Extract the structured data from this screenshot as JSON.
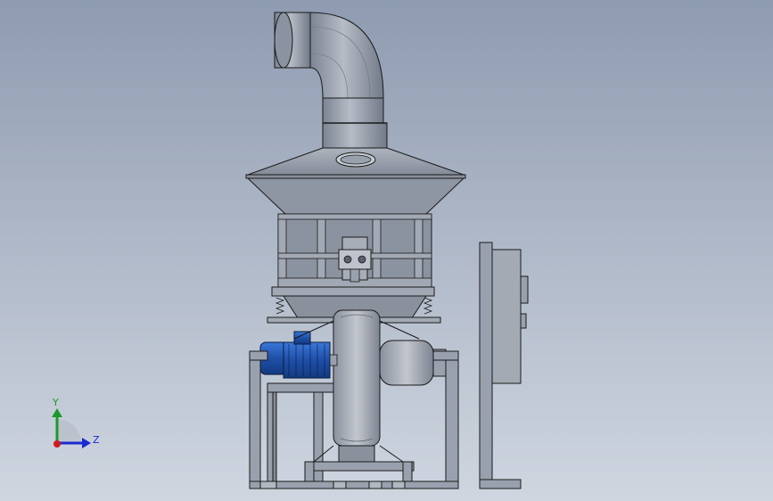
{
  "viewport": {
    "background_top": "#8e9bb0",
    "background_bottom": "#cfd6e0"
  },
  "model": {
    "body_color": "#9aa1ae",
    "edge_color": "#1a1a1a",
    "motor_color": "#1f4fa8",
    "motor_highlight": "#3a78d8"
  },
  "triad": {
    "y_label": "Y",
    "z_label": "Z",
    "y_color": "#1a9a2a",
    "z_color": "#1a2ad0",
    "origin_color": "#d01a1a"
  }
}
